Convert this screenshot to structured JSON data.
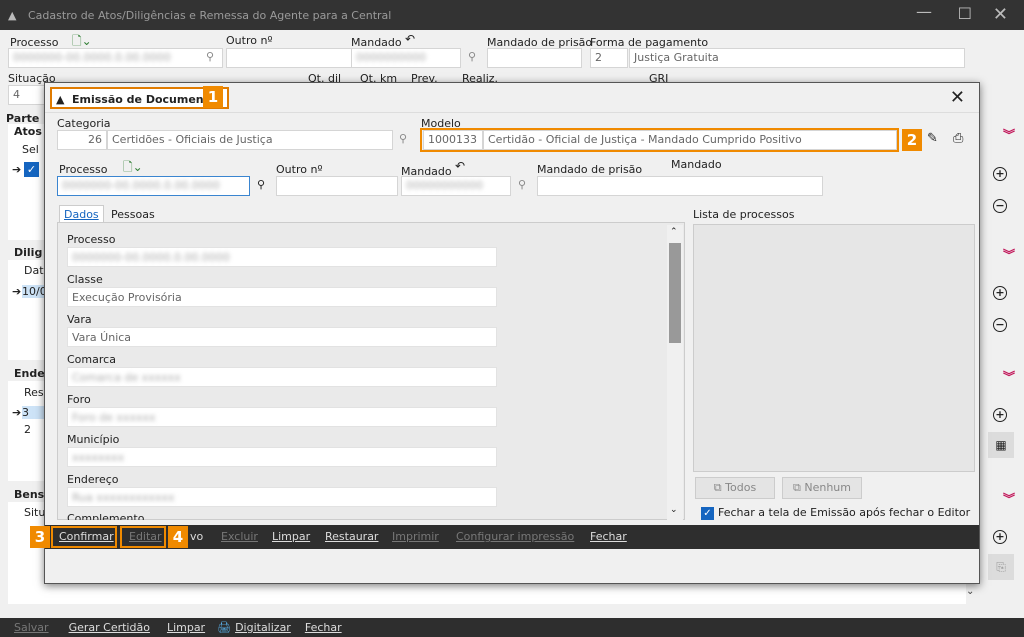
{
  "window": {
    "title": "Cadastro de Atos/Diligências e Remessa do Agente para a Central"
  },
  "header": {
    "processo_label": "Processo",
    "outro_label": "Outro nº",
    "mandado_label": "Mandado",
    "mandado_prisao_label": "Mandado de prisão",
    "forma_pag_label": "Forma de pagamento",
    "forma_pag_code": "2",
    "forma_pag_value": "Justiça Gratuita",
    "situacao_label": "Situação",
    "situacao_value": "4",
    "qt_dil": "Qt. dil",
    "qt_km": "Qt. km",
    "prev": "Prev.",
    "realiz": "Realiz.",
    "grj": "GRJ",
    "parte_label": "Parte :"
  },
  "left_partial": {
    "atos": "Atos",
    "sel": "Sel",
    "dilig": "Dilig",
    "data": "Data",
    "date_row": "10/0",
    "ender": "Ender",
    "res": "Res",
    "row3": "3",
    "row2": "2",
    "bens": "Bens",
    "situa": "Situa"
  },
  "bottom_bar": {
    "salvar": "Salvar",
    "gerar": "Gerar Certidão",
    "limpar": "Limpar",
    "digitalizar": "Digitalizar",
    "fechar": "Fechar"
  },
  "dialog": {
    "title": "Emissão de Documentos",
    "badge1": "1",
    "badge2": "2",
    "badge3": "3",
    "badge4": "4",
    "categoria_label": "Categoria",
    "categoria_code": "26",
    "categoria_value": "Certidões - Oficiais de Justiça",
    "modelo_label": "Modelo",
    "modelo_code": "1000133",
    "modelo_value": "Certidão - Oficial de Justiça - Mandado Cumprido Positivo",
    "processo_label": "Processo",
    "outro_label": "Outro nº",
    "mandado_label": "Mandado",
    "mandado_prisao_label": "Mandado de prisão",
    "mandado_label2": "Mandado",
    "tabs": [
      "Dados",
      "Pessoas"
    ],
    "lista_label": "Lista de processos",
    "fields": [
      {
        "label": "Processo",
        "value": ""
      },
      {
        "label": "Classe",
        "value": "Execução Provisória"
      },
      {
        "label": "Vara",
        "value": "Vara Única"
      },
      {
        "label": "Comarca",
        "value": ""
      },
      {
        "label": "Foro",
        "value": ""
      },
      {
        "label": "Município",
        "value": ""
      },
      {
        "label": "Endereço",
        "value": ""
      },
      {
        "label": "Complemento",
        "value": ""
      }
    ],
    "todos": "Todos",
    "nenhum": "Nenhum",
    "fechar_tela": "Fechar a tela de Emissão após fechar o Editor",
    "buttons": {
      "confirmar": "Confirmar",
      "editar": "Editar",
      "novo": "vo",
      "excluir": "Excluir",
      "limpar": "Limpar",
      "restaurar": "Restaurar",
      "imprimir": "Imprimir",
      "config": "Configurar impressão",
      "fechar": "Fechar"
    }
  }
}
